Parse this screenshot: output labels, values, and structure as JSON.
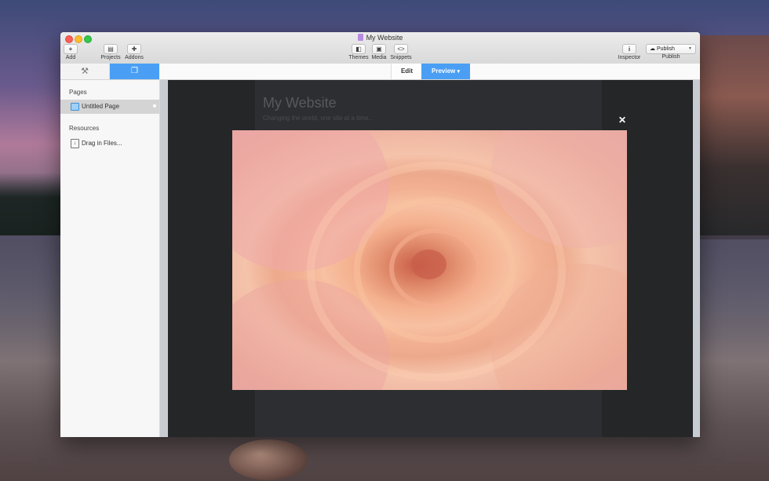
{
  "window": {
    "title": "My Website"
  },
  "toolbar": {
    "add": {
      "label": "Add",
      "glyph": "+"
    },
    "projects": {
      "label": "Projects",
      "glyph": "▤"
    },
    "addons": {
      "label": "Addons",
      "glyph": "✚"
    },
    "themes": {
      "label": "Themes",
      "glyph": "◧"
    },
    "media": {
      "label": "Media",
      "glyph": "▣"
    },
    "snippets": {
      "label": "Snippets",
      "glyph": "<>"
    },
    "inspector": {
      "label": "Inspector",
      "glyph": "i"
    },
    "publish": {
      "button_label": "Publish",
      "label": "Publish",
      "glyph": "☁"
    }
  },
  "mode_bar": {
    "edit_label": "Edit",
    "preview_label": "Preview",
    "preview_caret": "▾",
    "settings_icon": "⚒",
    "pages_icon": "❐"
  },
  "sidebar": {
    "pages_heading": "Pages",
    "pages": [
      {
        "label": "Untitled Page",
        "selected": true
      }
    ],
    "resources_heading": "Resources",
    "drag_label": "Drag in Files..."
  },
  "preview": {
    "site_title": "My Website",
    "site_tagline": "Changing the world, one site at a time...",
    "close_glyph": "✕"
  },
  "colors": {
    "accent": "#4a9ff5",
    "preview_bg": "#2f3134"
  }
}
